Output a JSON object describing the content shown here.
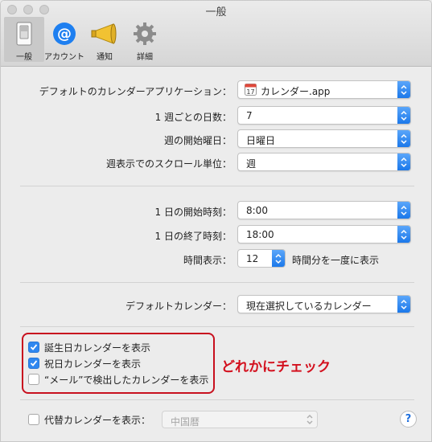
{
  "window": {
    "title": "一般"
  },
  "toolbar": {
    "items": [
      {
        "label": "一般",
        "icon": "switch-icon",
        "selected": true
      },
      {
        "label": "アカウント",
        "icon": "at-sign-icon",
        "selected": false
      },
      {
        "label": "通知",
        "icon": "megaphone-icon",
        "selected": false
      },
      {
        "label": "詳細",
        "icon": "gear-icon",
        "selected": false
      }
    ]
  },
  "settings": {
    "default_app": {
      "label": "デフォルトのカレンダーアプリケーション：",
      "value": "カレンダー.app"
    },
    "days_per_week": {
      "label": "1 週ごとの日数：",
      "value": "7"
    },
    "week_start": {
      "label": "週の開始曜日：",
      "value": "日曜日"
    },
    "scroll_unit": {
      "label": "週表示でのスクロール単位：",
      "value": "週"
    },
    "day_start": {
      "label": "1 日の開始時刻：",
      "value": "8:00"
    },
    "day_end": {
      "label": "1 日の終了時刻：",
      "value": "18:00"
    },
    "time_display": {
      "label": "時間表示：",
      "value": "12",
      "suffix": "時間分を一度に表示"
    },
    "default_calendar": {
      "label": "デフォルトカレンダー：",
      "value": "現在選択しているカレンダー"
    }
  },
  "checks": {
    "birthdays": {
      "label": "誕生日カレンダーを表示",
      "checked": true
    },
    "holidays": {
      "label": "祝日カレンダーを表示",
      "checked": true
    },
    "mail_found": {
      "label": "“メール”で検出したカレンダーを表示",
      "checked": false
    },
    "alt_calendar": {
      "label": "代替カレンダーを表示：",
      "checked": false,
      "value": "中国暦"
    }
  },
  "annotation": {
    "text": "どれかにチェック",
    "color": "#d3101e"
  },
  "help": {
    "label": "?"
  },
  "colors": {
    "accent": "#2f87f0",
    "highlight": "#c8101e"
  }
}
